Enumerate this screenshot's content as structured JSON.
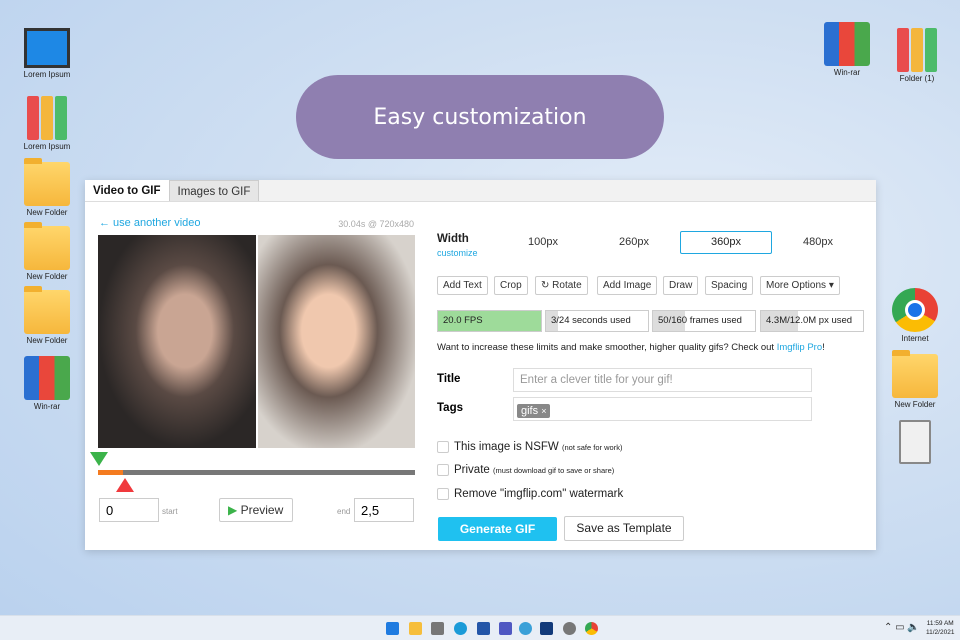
{
  "desktop": {
    "left_icons": [
      "Lorem Ipsum",
      "Lorem Ipsum",
      "New Folder",
      "New Folder",
      "New Folder",
      "Win-rar"
    ],
    "right_icons": [
      "Win-rar",
      "Folder (1)",
      "Internet",
      "New Folder"
    ]
  },
  "banner": "Easy customization",
  "tabs": [
    "Video to GIF",
    "Images to GIF"
  ],
  "video": {
    "back_link": "← use another video",
    "info": "30.04s @ 720x480",
    "start_value": "0",
    "start_label": "start",
    "preview_label": "Preview",
    "end_label": "end",
    "end_value": "2,5",
    "selection_fraction": 0.08
  },
  "width": {
    "label": "Width",
    "customize": "customize",
    "options": [
      "100px",
      "260px",
      "360px",
      "480px"
    ],
    "selected": "360px"
  },
  "tools": [
    "Add Text",
    "Crop",
    "Rotate",
    "Add Image",
    "Draw",
    "Spacing",
    "More Options"
  ],
  "limits": [
    {
      "label": "20.0 FPS",
      "fill": 1.0
    },
    {
      "label": "3/24 seconds used",
      "fill": 0.12
    },
    {
      "label": "50/160 frames used",
      "fill": 0.31
    },
    {
      "label": "4.3M/12.0M px used",
      "fill": 0.36
    }
  ],
  "upsell": {
    "text": "Want to increase these limits and make smoother, higher quality gifs? Check out ",
    "link": "Imgflip Pro",
    "end": "!"
  },
  "form": {
    "title_label": "Title",
    "title_placeholder": "Enter a clever title for your gif!",
    "tags_label": "Tags",
    "tag": "gifs",
    "tag_remove": "×"
  },
  "options": [
    {
      "label": "This image is NSFW",
      "note": "(not safe for work)"
    },
    {
      "label": "Private",
      "note": "(must download gif to save or share)"
    },
    {
      "label": "Remove \"imgflip.com\" watermark",
      "note": ""
    }
  ],
  "generate": "Generate GIF",
  "save_template": "Save as Template",
  "taskbar": {
    "time": "11:59 AM",
    "date": "11/2/2021"
  }
}
